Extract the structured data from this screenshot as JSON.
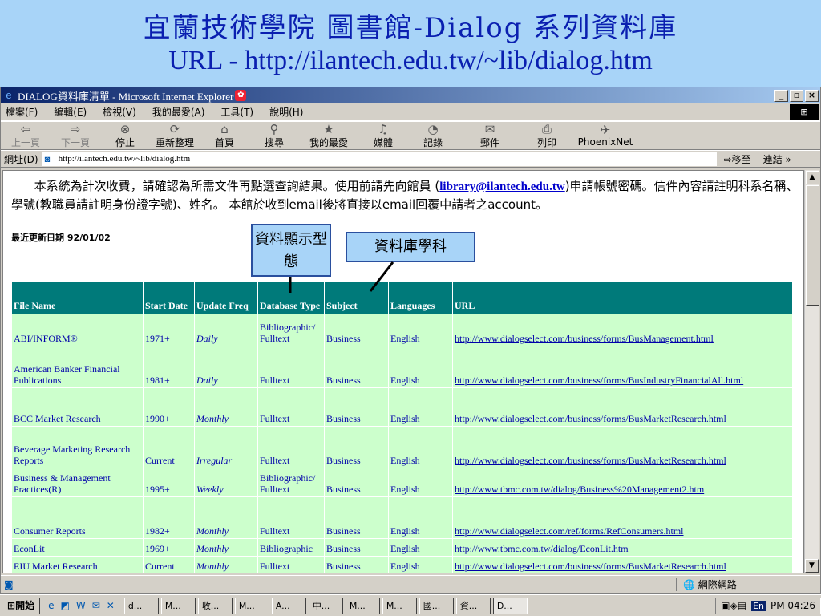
{
  "slide": {
    "title_line1": "宜蘭技術學院 圖書館-Dialog 系列資料庫",
    "title_line2": "URL - http://ilantech.edu.tw/~lib/dialog.htm"
  },
  "window": {
    "title": "DIALOG資料庫清單 - Microsoft Internet Explorer",
    "buttons": [
      "_",
      "▫",
      "×"
    ]
  },
  "menu": [
    "檔案(F)",
    "編輯(E)",
    "檢視(V)",
    "我的最愛(A)",
    "工具(T)",
    "說明(H)"
  ],
  "toolbar": [
    {
      "label": "上一頁",
      "icon": "back-icon",
      "glyph": "⇦"
    },
    {
      "label": "下一頁",
      "icon": "forward-icon",
      "glyph": "⇨"
    },
    {
      "label": "停止",
      "icon": "stop-icon",
      "glyph": "⊗"
    },
    {
      "label": "重新整理",
      "icon": "refresh-icon",
      "glyph": "⟳"
    },
    {
      "label": "首頁",
      "icon": "home-icon",
      "glyph": "⌂"
    },
    {
      "label": "搜尋",
      "icon": "search-icon",
      "glyph": "⚲"
    },
    {
      "label": "我的最愛",
      "icon": "favorites-icon",
      "glyph": "★"
    },
    {
      "label": "媒體",
      "icon": "media-icon",
      "glyph": "♫"
    },
    {
      "label": "記錄",
      "icon": "history-icon",
      "glyph": "◔"
    },
    {
      "label": "郵件",
      "icon": "mail-icon",
      "glyph": "✉"
    },
    {
      "label": "列印",
      "icon": "print-icon",
      "glyph": "⎙"
    },
    {
      "label": "PhoenixNet",
      "icon": "phoenixnet-icon",
      "glyph": "✈"
    }
  ],
  "address": {
    "label": "網址(D)",
    "value": "http://ilantech.edu.tw/~lib/dialog.htm",
    "go": "移至",
    "links": "連結 »"
  },
  "page": {
    "intro_before": "本系統為計次收費，請確認為所需文件再點選查詢結果。使用前請先向館員 (",
    "email": "library@ilantech.edu.tw",
    "intro_after": ")申請帳號密碼。信件內容請註明科系名稱、學號(教職員請註明身份證字號)、姓名。 本館於收到email後將直接以email回覆中請者之account。",
    "updated": "最近更新日期 92/01/02"
  },
  "callouts": {
    "type": "資料顯示型態",
    "subject": "資料庫學科"
  },
  "table": {
    "headers": [
      "File Name",
      "Start Date",
      "Update Freq",
      "Database Type",
      "Subject",
      "Languages",
      "URL"
    ],
    "rows": [
      [
        "ABI/INFORM®",
        "1971+",
        "Daily",
        "Bibliographic/ Fulltext",
        "Business",
        "English",
        "http://www.dialogselect.com/business/forms/BusManagement.html"
      ],
      [
        "American Banker Financial Publications",
        "1981+",
        "Daily",
        "Fulltext",
        "Business",
        "English",
        "http://www.dialogselect.com/business/forms/BusIndustryFinancialAll.html"
      ],
      [
        "BCC Market Research",
        "1990+",
        "Monthly",
        "Fulltext",
        "Business",
        "English",
        "http://www.dialogselect.com/business/forms/BusMarketResearch.html"
      ],
      [
        "Beverage Marketing Research Reports",
        "Current",
        "Irregular",
        "Fulltext",
        "Business",
        "English",
        "http://www.dialogselect.com/business/forms/BusMarketResearch.html"
      ],
      [
        "Business & Management Practices(R)",
        "1995+",
        "Weekly",
        "Bibliographic/ Fulltext",
        "Business",
        "English",
        "http://www.tbmc.com.tw/dialog/Business%20Management2.htm"
      ],
      [
        "Consumer Reports",
        "1982+",
        "Monthly",
        "Fulltext",
        "Business",
        "English",
        "http://www.dialogselect.com/ref/forms/RefConsumers.html"
      ],
      [
        "EconLit",
        "1969+",
        "Monthly",
        "Bibliographic",
        "Business",
        "English",
        "http://www.tbmc.com.tw/dialog/EconLit.htm"
      ],
      [
        "EIU Market Research",
        "Current",
        "Monthly",
        "Fulltext",
        "Business",
        "English",
        "http://www.dialogselect.com/business/forms/BusMarketResearch.html"
      ]
    ]
  },
  "status": {
    "zone": "網際網路"
  },
  "taskbar": {
    "start": "開始",
    "tasks": [
      "d...",
      "M...",
      "收...",
      "M...",
      "A...",
      "中...",
      "M...",
      "M...",
      "國...",
      "資...",
      "D..."
    ],
    "ime": "En",
    "clock": "PM 04:26"
  }
}
